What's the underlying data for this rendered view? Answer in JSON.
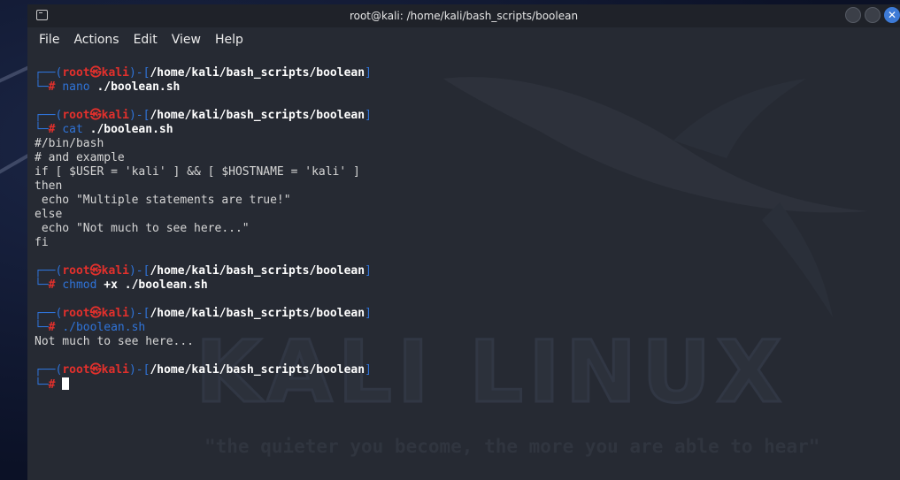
{
  "window": {
    "title": "root@kali: /home/kali/bash_scripts/boolean"
  },
  "menu": {
    "items": [
      "File",
      "Actions",
      "Edit",
      "View",
      "Help"
    ]
  },
  "prompt": {
    "user": "root",
    "at": "㉿",
    "host": "kali",
    "path": "/home/kali/bash_scripts/boolean",
    "symbol": "#"
  },
  "session": [
    {
      "cmd": "nano",
      "arg": " ./boolean.sh",
      "output": []
    },
    {
      "cmd": "cat",
      "arg": " ./boolean.sh",
      "output": [
        "#/bin/bash",
        "# and example",
        "if [ $USER = 'kali' ] && [ $HOSTNAME = 'kali' ]",
        "then",
        " echo \"Multiple statements are true!\"",
        "else",
        " echo \"Not much to see here...\"",
        "fi"
      ]
    },
    {
      "cmd": "chmod",
      "arg": " +x ./boolean.sh",
      "output": []
    },
    {
      "cmd": "./boolean.sh",
      "arg": "",
      "output": [
        "Not much to see here..."
      ]
    }
  ],
  "background": {
    "watermark": "KALI LINUX",
    "slogan": "\"the quieter you become, the more you are able to hear\""
  },
  "colors": {
    "prompt_frame": "#2f73d8",
    "prompt_user": "#e3302c",
    "terminal_bg": "#262a33",
    "close_button": "#3d7ad6"
  }
}
